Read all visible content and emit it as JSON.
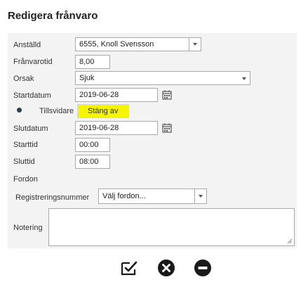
{
  "dialog": {
    "title": "Redigera frånvaro"
  },
  "form": {
    "employee": {
      "label": "Anställd",
      "value": "6555, Knoll Svensson"
    },
    "absence_time": {
      "label": "Frånvarotid",
      "value": "8,00"
    },
    "reason": {
      "label": "Orsak",
      "value": "Sjuk"
    },
    "start_date": {
      "label": "Startdatum",
      "value": "2019-06-28"
    },
    "until_further": {
      "label": "Tillsvidare",
      "toggle_label": "Stäng av"
    },
    "end_date": {
      "label": "Slutdatum",
      "value": "2019-06-28"
    },
    "start_time": {
      "label": "Starttid",
      "value": "00:00"
    },
    "end_time": {
      "label": "Sluttid",
      "value": "08:00"
    },
    "vehicle_section": {
      "label": "Fordon"
    },
    "registration": {
      "label": "Registreringsnummer",
      "value": "Välj fordon..."
    },
    "note": {
      "label": "Notering",
      "value": ""
    }
  },
  "actions": {
    "save_icon": "edit-check-icon",
    "cancel_icon": "close-circle-icon",
    "remove_icon": "minus-circle-icon"
  },
  "colors": {
    "highlight": "#f5f500",
    "panel": "#f3f3f3",
    "icon": "#1a1a1a"
  }
}
